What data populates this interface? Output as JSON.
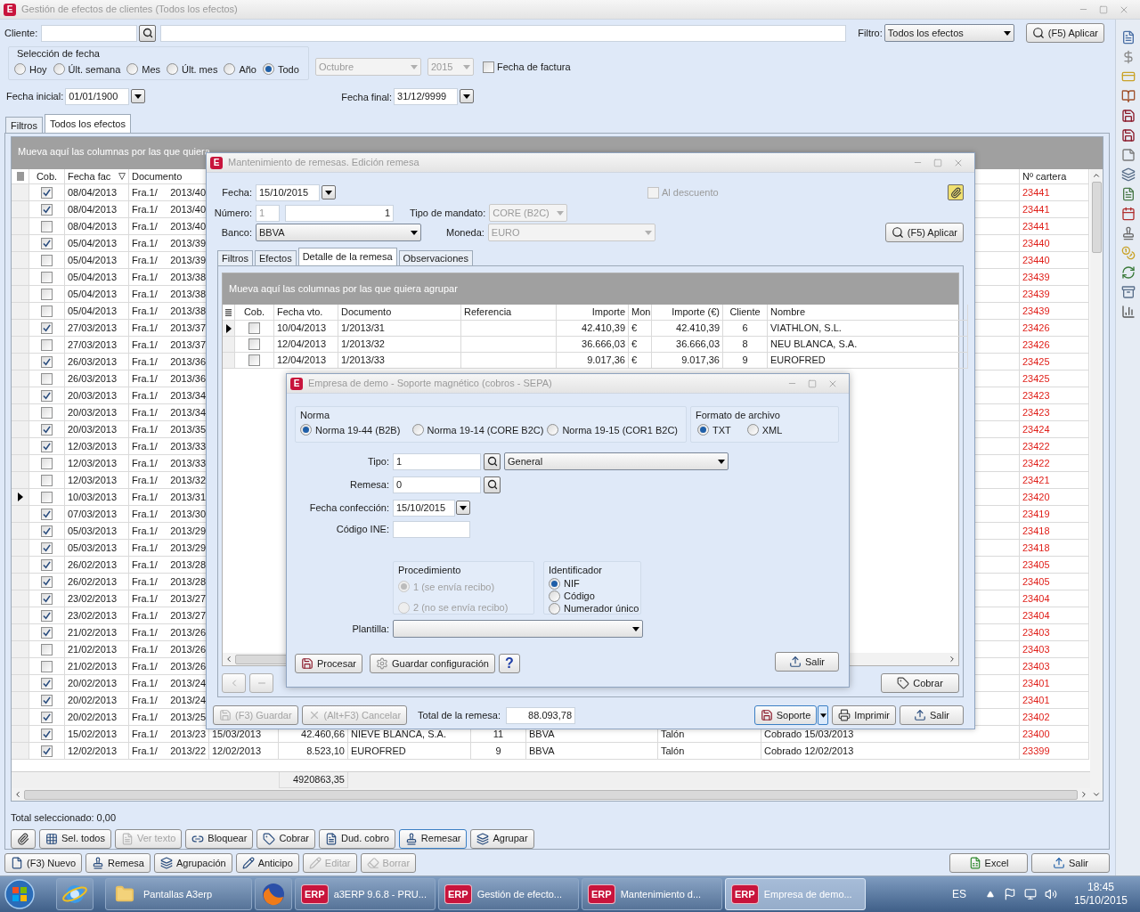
{
  "main": {
    "icon_letter": "E",
    "title": "Gestión de efectos de clientes (Todos los efectos)",
    "cliente_label": "Cliente:",
    "filter_label": "Filtro:",
    "filter_value": "Todos los efectos",
    "apply_button": "(F5) Aplicar",
    "date_group": {
      "title": "Selección de fecha",
      "options": [
        {
          "label": "Hoy",
          "selected": false
        },
        {
          "label": "Últ. semana",
          "selected": false
        },
        {
          "label": "Mes",
          "selected": false
        },
        {
          "label": "Últ. mes",
          "selected": false
        },
        {
          "label": "Año",
          "selected": false
        },
        {
          "label": "Todo",
          "selected": true
        }
      ]
    },
    "month": {
      "value": "Octubre",
      "disabled": true
    },
    "year": {
      "value": "2015",
      "disabled": true
    },
    "invoice_date": {
      "label": "Fecha de factura",
      "checked": false
    },
    "start_date": {
      "label": "Fecha inicial:",
      "value": "01/01/1900"
    },
    "end_date": {
      "label": "Fecha final:",
      "value": "31/12/9999"
    },
    "tabs": [
      {
        "label": "Filtros",
        "selected": false
      },
      {
        "label": "Todos los efectos",
        "selected": true
      }
    ],
    "grid": {
      "group_hint": "Mueva aquí las columnas por las que quiera",
      "columns": [
        "Cob.",
        "Fecha fac",
        "Documento",
        "Nº cartera"
      ],
      "rows": [
        {
          "checked": true,
          "current": false,
          "date": "08/04/2013",
          "series": "Fra.1/",
          "number": "2013/40",
          "portfolio": "23441"
        },
        {
          "checked": true,
          "current": false,
          "date": "08/04/2013",
          "series": "Fra.1/",
          "number": "2013/40",
          "portfolio": "23441"
        },
        {
          "checked": false,
          "current": false,
          "date": "08/04/2013",
          "series": "Fra.1/",
          "number": "2013/40",
          "portfolio": "23441"
        },
        {
          "checked": true,
          "current": false,
          "date": "05/04/2013",
          "series": "Fra.1/",
          "number": "2013/39",
          "portfolio": "23440"
        },
        {
          "checked": false,
          "current": false,
          "date": "05/04/2013",
          "series": "Fra.1/",
          "number": "2013/39",
          "portfolio": "23440"
        },
        {
          "checked": false,
          "current": false,
          "date": "05/04/2013",
          "series": "Fra.1/",
          "number": "2013/38",
          "portfolio": "23439"
        },
        {
          "checked": false,
          "current": false,
          "date": "05/04/2013",
          "series": "Fra.1/",
          "number": "2013/38",
          "portfolio": "23439"
        },
        {
          "checked": false,
          "current": false,
          "date": "05/04/2013",
          "series": "Fra.1/",
          "number": "2013/38",
          "portfolio": "23439"
        },
        {
          "checked": true,
          "current": false,
          "date": "27/03/2013",
          "series": "Fra.1/",
          "number": "2013/37",
          "portfolio": "23426"
        },
        {
          "checked": false,
          "current": false,
          "date": "27/03/2013",
          "series": "Fra.1/",
          "number": "2013/37",
          "portfolio": "23426"
        },
        {
          "checked": true,
          "current": false,
          "date": "26/03/2013",
          "series": "Fra.1/",
          "number": "2013/36",
          "portfolio": "23425"
        },
        {
          "checked": false,
          "current": false,
          "date": "26/03/2013",
          "series": "Fra.1/",
          "number": "2013/36",
          "portfolio": "23425"
        },
        {
          "checked": true,
          "current": false,
          "date": "20/03/2013",
          "series": "Fra.1/",
          "number": "2013/34",
          "portfolio": "23423"
        },
        {
          "checked": false,
          "current": false,
          "date": "20/03/2013",
          "series": "Fra.1/",
          "number": "2013/34",
          "portfolio": "23423"
        },
        {
          "checked": true,
          "current": false,
          "date": "20/03/2013",
          "series": "Fra.1/",
          "number": "2013/35",
          "portfolio": "23424"
        },
        {
          "checked": true,
          "current": false,
          "date": "12/03/2013",
          "series": "Fra.1/",
          "number": "2013/33",
          "portfolio": "23422"
        },
        {
          "checked": false,
          "current": false,
          "date": "12/03/2013",
          "series": "Fra.1/",
          "number": "2013/33",
          "portfolio": "23422"
        },
        {
          "checked": false,
          "current": false,
          "date": "12/03/2013",
          "series": "Fra.1/",
          "number": "2013/32",
          "portfolio": "23421"
        },
        {
          "checked": false,
          "current": true,
          "date": "10/03/2013",
          "series": "Fra.1/",
          "number": "2013/31",
          "portfolio": "23420"
        },
        {
          "checked": true,
          "current": false,
          "date": "07/03/2013",
          "series": "Fra.1/",
          "number": "2013/30",
          "portfolio": "23419"
        },
        {
          "checked": true,
          "current": false,
          "date": "05/03/2013",
          "series": "Fra.1/",
          "number": "2013/29",
          "portfolio": "23418"
        },
        {
          "checked": true,
          "current": false,
          "date": "05/03/2013",
          "series": "Fra.1/",
          "number": "2013/29",
          "portfolio": "23418"
        },
        {
          "checked": true,
          "current": false,
          "date": "26/02/2013",
          "series": "Fra.1/",
          "number": "2013/28",
          "portfolio": "23405"
        },
        {
          "checked": true,
          "current": false,
          "date": "26/02/2013",
          "series": "Fra.1/",
          "number": "2013/28",
          "portfolio": "23405"
        },
        {
          "checked": true,
          "current": false,
          "date": "23/02/2013",
          "series": "Fra.1/",
          "number": "2013/27",
          "portfolio": "23404"
        },
        {
          "checked": true,
          "current": false,
          "date": "23/02/2013",
          "series": "Fra.1/",
          "number": "2013/27",
          "portfolio": "23404"
        },
        {
          "checked": true,
          "current": false,
          "date": "21/02/2013",
          "series": "Fra.1/",
          "number": "2013/26",
          "portfolio": "23403"
        },
        {
          "checked": false,
          "current": false,
          "date": "21/02/2013",
          "series": "Fra.1/",
          "number": "2013/26",
          "portfolio": "23403"
        },
        {
          "checked": false,
          "current": false,
          "date": "21/02/2013",
          "series": "Fra.1/",
          "number": "2013/26",
          "portfolio": "23403"
        },
        {
          "checked": true,
          "current": false,
          "date": "20/02/2013",
          "series": "Fra.1/",
          "number": "2013/24",
          "portfolio": "23401"
        },
        {
          "checked": true,
          "current": false,
          "date": "20/02/2013",
          "series": "Fra.1/",
          "number": "2013/24",
          "portfolio": "23401"
        },
        {
          "checked": true,
          "current": false,
          "date": "20/02/2013",
          "series": "Fra.1/",
          "number": "2013/25",
          "portfolio": "23402"
        },
        {
          "checked": true,
          "current": false,
          "date": "15/02/2013",
          "series": "Fra.1/",
          "number": "2013/23",
          "portfolio": "23400",
          "extra": [
            "15/03/2013",
            "42.460,66",
            "NIEVE BLANCA, S.A.",
            "11",
            "BBVA",
            "Talón",
            "Cobrado 15/03/2013"
          ]
        },
        {
          "checked": true,
          "current": false,
          "date": "12/02/2013",
          "series": "Fra.1/",
          "number": "2013/22",
          "portfolio": "23399",
          "extra": [
            "12/02/2013",
            "8.523,10",
            "EUROFRED",
            "9",
            "BBVA",
            "Talón",
            "Cobrado 12/02/2013"
          ]
        }
      ],
      "total": "4920863,35"
    },
    "selected_total": "Total seleccionado: 0,00",
    "actions": [
      {
        "label": "Sel. todos",
        "disabled": false,
        "focused": false
      },
      {
        "label": "Ver texto",
        "disabled": true,
        "focused": false
      },
      {
        "label": "Bloquear",
        "disabled": false,
        "focused": false
      },
      {
        "label": "Cobrar",
        "disabled": false,
        "focused": false
      },
      {
        "label": "Dud. cobro",
        "disabled": false,
        "focused": false
      },
      {
        "label": "Remesar",
        "disabled": false,
        "focused": true
      },
      {
        "label": "Agrupar",
        "disabled": false,
        "focused": false
      }
    ],
    "left_buttons": [
      {
        "label": "(F3) Nuevo",
        "disabled": false
      },
      {
        "label": "Remesa",
        "disabled": false
      },
      {
        "label": "Agrupación",
        "disabled": false
      },
      {
        "label": "Anticipo",
        "disabled": false
      },
      {
        "label": "Editar",
        "disabled": true
      },
      {
        "label": "Borrar",
        "disabled": true
      }
    ],
    "right_buttons": [
      {
        "label": "Excel",
        "disabled": false
      },
      {
        "label": "Salir",
        "disabled": false
      }
    ]
  },
  "remesa_window": {
    "icon_letter": "E",
    "title": "Mantenimiento de remesas. Edición remesa",
    "date": {
      "label": "Fecha:",
      "value": "15/10/2015"
    },
    "discount": {
      "label": "Al descuento",
      "checked": false,
      "disabled": true
    },
    "number": {
      "label": "Número:",
      "series": "1",
      "value": "1"
    },
    "mandate": {
      "label": "Tipo de mandato:",
      "value": "CORE (B2C)",
      "disabled": true
    },
    "bank": {
      "label": "Banco:",
      "value": "BBVA"
    },
    "currency": {
      "label": "Moneda:",
      "value": "EURO",
      "disabled": true
    },
    "apply_button": "(F5) Aplicar",
    "tabs": [
      {
        "label": "Filtros",
        "selected": false
      },
      {
        "label": "Efectos",
        "selected": false
      },
      {
        "label": "Detalle de la remesa",
        "selected": true
      },
      {
        "label": "Observaciones",
        "selected": false
      }
    ],
    "grid": {
      "group_hint": "Mueva aquí las columnas por las que quiera agrupar",
      "columns": [
        "Cob.",
        "Fecha vto.",
        "Documento",
        "Referencia",
        "Importe",
        "Mon",
        "Importe (€)",
        "Cliente",
        "Nombre"
      ],
      "rows": [
        {
          "current": true,
          "checked": false,
          "due": "10/04/2013",
          "document": "1/2013/31",
          "amount": "42.410,39",
          "currency": "€",
          "amount_eur": "42.410,39",
          "client": "6",
          "name": "VIATHLON, S.L."
        },
        {
          "current": false,
          "checked": false,
          "due": "12/04/2013",
          "document": "1/2013/32",
          "amount": "36.666,03",
          "currency": "€",
          "amount_eur": "36.666,03",
          "client": "8",
          "name": "NEU BLANCA, S.A."
        },
        {
          "current": false,
          "checked": false,
          "due": "12/04/2013",
          "document": "1/2013/33",
          "amount": "9.017,36",
          "currency": "€",
          "amount_eur": "9.017,36",
          "client": "9",
          "name": "EUROFRED"
        }
      ]
    },
    "collect_button": "Cobrar",
    "save_button": {
      "label": "(F3) Guardar",
      "disabled": true
    },
    "cancel_button": {
      "label": "(Alt+F3) Cancelar",
      "disabled": true
    },
    "total": {
      "label": "Total de la remesa:",
      "value": "88.093,78"
    },
    "support_button": "Soporte",
    "print_button": "Imprimir",
    "exit_button": "Salir"
  },
  "soporte_window": {
    "icon_letter": "E",
    "title": "Empresa de demo - Soporte magnético (cobros - SEPA)",
    "norma": {
      "title": "Norma",
      "options": [
        {
          "label": "Norma 19-44 (B2B)",
          "selected": true
        },
        {
          "label": "Norma 19-14 (CORE B2C)",
          "selected": false
        },
        {
          "label": "Norma 19-15 (COR1 B2C)",
          "selected": false
        }
      ]
    },
    "format": {
      "title": "Formato de archivo",
      "options": [
        {
          "label": "TXT",
          "selected": true
        },
        {
          "label": "XML",
          "selected": false
        }
      ]
    },
    "type": {
      "label": "Tipo:",
      "value": "1",
      "description": "General"
    },
    "remittance": {
      "label": "Remesa:",
      "value": "0"
    },
    "date": {
      "label": "Fecha confección:",
      "value": "15/10/2015"
    },
    "ine": {
      "label": "Código INE:"
    },
    "procedure": {
      "title": "Procedimiento",
      "disabled": true,
      "options": [
        {
          "label": "1 (se envía recibo)",
          "selected": true
        },
        {
          "label": "2 (no se envía recibo)",
          "selected": false
        }
      ]
    },
    "identifier": {
      "title": "Identificador",
      "options": [
        {
          "label": "NIF",
          "selected": true
        },
        {
          "label": "Código",
          "selected": false
        },
        {
          "label": "Numerador único",
          "selected": false
        }
      ]
    },
    "template": {
      "label": "Plantilla:"
    },
    "process_button": "Procesar",
    "save_config_button": "Guardar configuración",
    "help_button": "?",
    "exit_button": "Salir"
  },
  "taskbar": {
    "items": [
      {
        "kind": "ie",
        "active": false
      },
      {
        "kind": "folder",
        "label": "Pantallas A3erp",
        "active": false
      },
      {
        "kind": "firefox",
        "active": false
      },
      {
        "kind": "erp",
        "badge": "ERP",
        "label": "a3ERP 9.6.8 - PRU...",
        "active": false
      },
      {
        "kind": "erp",
        "badge": "ERP",
        "label": "Gestión de efecto...",
        "active": false
      },
      {
        "kind": "erp",
        "badge": "ERP",
        "label": "Mantenimiento d...",
        "active": false
      },
      {
        "kind": "erp",
        "badge": "ERP",
        "label": "Empresa de demo...",
        "active": true
      }
    ],
    "language": "ES",
    "time": "18:45",
    "date": "15/10/2015"
  }
}
